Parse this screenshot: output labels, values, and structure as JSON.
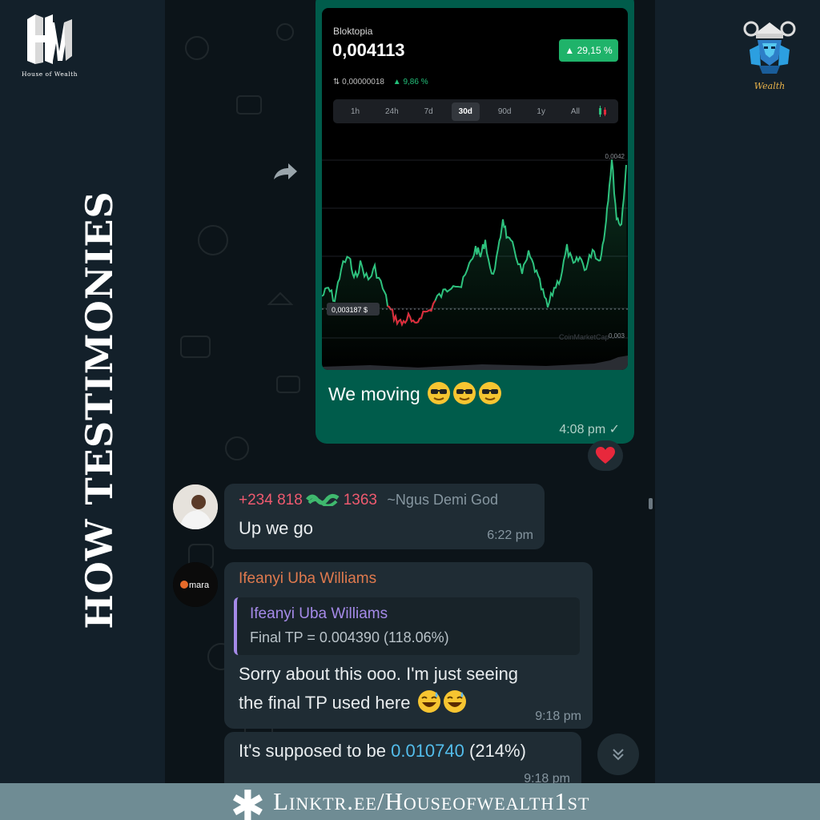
{
  "brand": {
    "left_logo_letters": "HW",
    "left_logo_caption": "House of Wealth",
    "right_logo_text": "Wealth",
    "side_title": "HOW TESTIMONIES",
    "footer_link": "Linktr.ee/Houseofwealth1st"
  },
  "outgoing_message": {
    "screenshot": {
      "coin_name": "Bloktopia",
      "price": "0,004113",
      "change_badge": "▲ 29,15 %",
      "sub_value": "⇅ 0,00000018",
      "sub_change": "▲ 9,86 %",
      "ranges": [
        "1h",
        "24h",
        "7d",
        "30d",
        "90d",
        "1y",
        "All"
      ],
      "active_range": "30d",
      "price_tag": "0,003187 $",
      "axis_top": "0,0042",
      "axis_bottom": "0,003",
      "watermark": "CoinMarketCap",
      "up_color": "#2ec27e",
      "down_color": "#e0283a"
    },
    "text": "We moving",
    "emoji": [
      "smiling-face-with-sunglasses",
      "smiling-face-with-sunglasses",
      "smiling-face-with-sunglasses"
    ],
    "time": "4:08 pm ✓",
    "reaction": "❤️"
  },
  "incoming_messages": [
    {
      "sender_phone_start": "+234 818",
      "sender_phone_end": "1363",
      "sender_name": "~Ngus Demi God",
      "text": "Up we go",
      "time": "6:22 pm",
      "phone_color": "#ef5a6f"
    },
    {
      "sender": "Ifeanyi Uba Williams",
      "sender_color": "#e07a4e",
      "avatar_text": "mara",
      "quote_author": "Ifeanyi Uba Williams",
      "quote_text": "Final TP = 0.004390 (118.06%)",
      "text_line1": "Sorry about this ooo. I'm just seeing",
      "text_line2": "the final TP used here",
      "emoji": [
        "grinning-face-with-sweat",
        "grinning-face-with-sweat"
      ],
      "time": "9:18 pm"
    },
    {
      "text_before": "It's supposed to be ",
      "text_link": "0.010740",
      "text_after": " (214%)",
      "time": "9:18 pm"
    }
  ]
}
